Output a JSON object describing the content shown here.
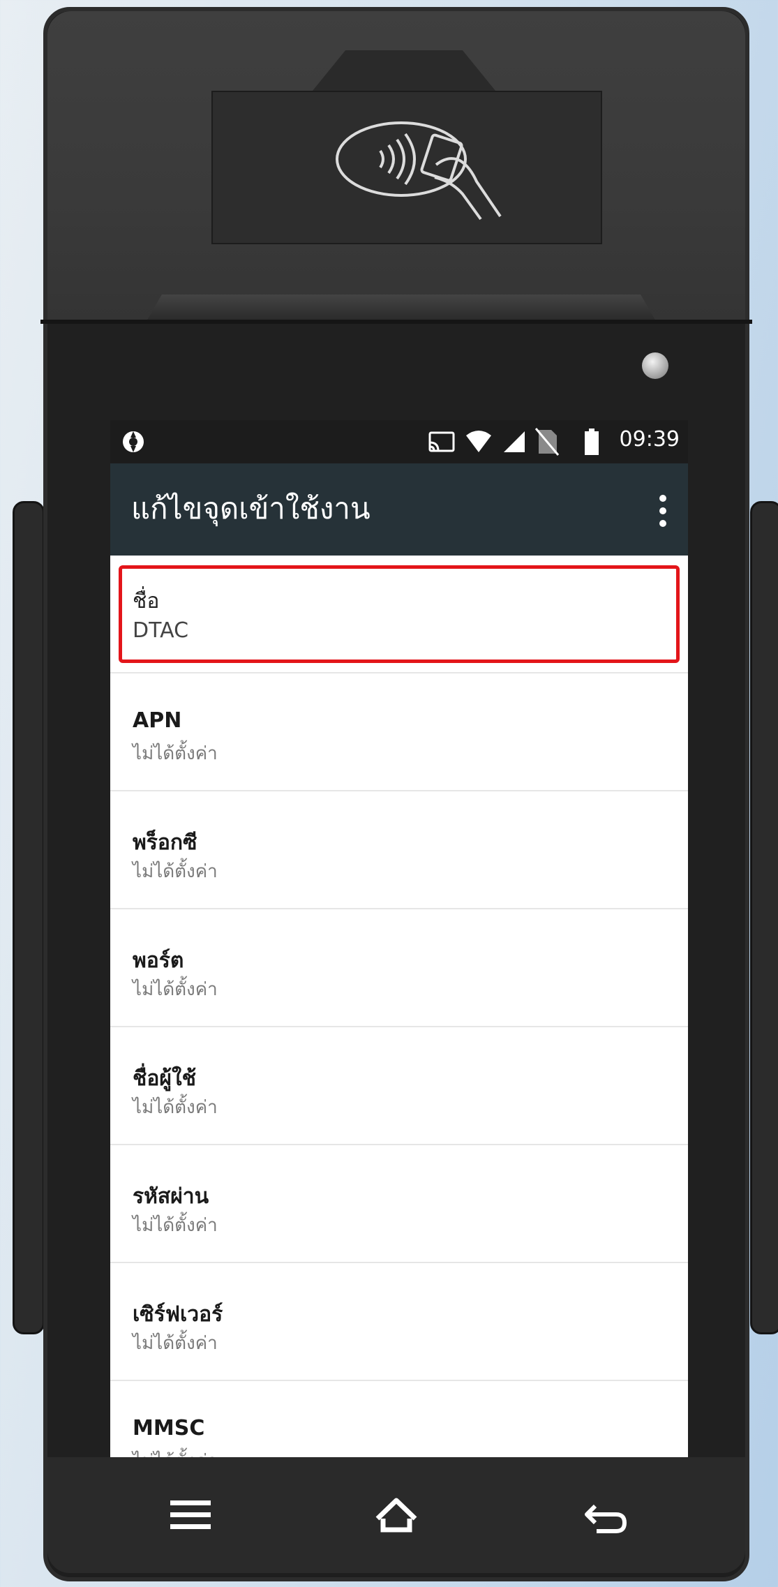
{
  "status_bar": {
    "time": "09:39",
    "icons": [
      "sync-icon",
      "cast-icon",
      "wifi-icon",
      "cell-signal-icon",
      "no-sim-icon",
      "battery-icon"
    ]
  },
  "app_bar": {
    "title": "แก้ไขจุดเข้าใช้งาน",
    "menu_icon": "more-vert-icon"
  },
  "fields": [
    {
      "label": "ชื่อ",
      "value": "DTAC"
    },
    {
      "label": "APN",
      "value": "ไม่ได้ตั้งค่า"
    },
    {
      "label": "พร็อกซี",
      "value": "ไม่ได้ตั้งค่า"
    },
    {
      "label": "พอร์ต",
      "value": "ไม่ได้ตั้งค่า"
    },
    {
      "label": "ชื่อผู้ใช้",
      "value": "ไม่ได้ตั้งค่า"
    },
    {
      "label": "รหัสผ่าน",
      "value": "ไม่ได้ตั้งค่า"
    },
    {
      "label": "เซิร์ฟเวอร์",
      "value": "ไม่ได้ตั้งค่า"
    },
    {
      "label": "MMSC",
      "value": "ไม่ได้ตั้งค่า"
    }
  ],
  "nav_bar": {
    "icons": [
      "menu-icon",
      "home-icon",
      "back-icon"
    ]
  },
  "colors": {
    "app_bar": "#263238",
    "highlight": "#e3151a",
    "device_body": "#1e1e1e"
  }
}
